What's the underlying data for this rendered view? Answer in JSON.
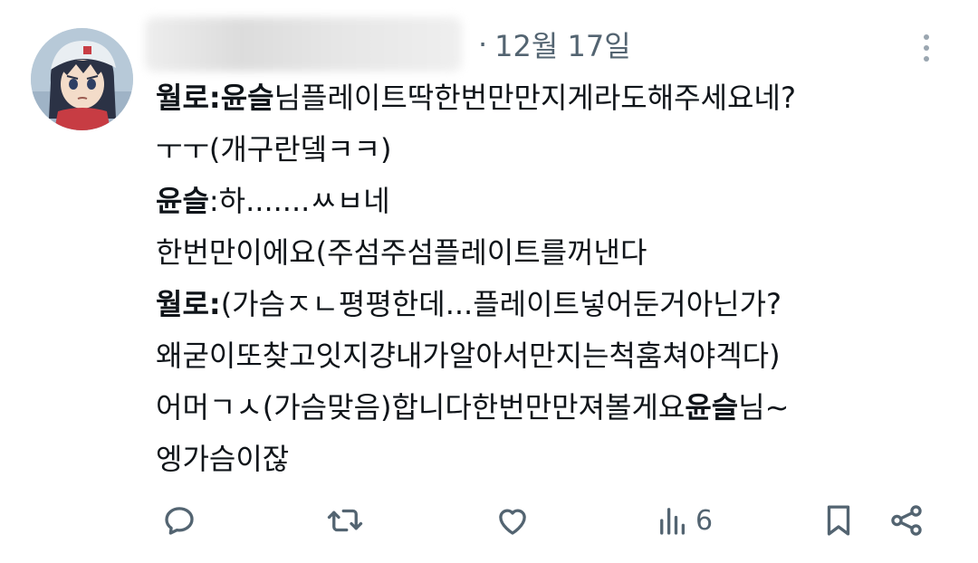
{
  "header": {
    "separator": "·",
    "date": "12월 17일"
  },
  "tweet": {
    "lines": [
      [
        {
          "text": "월로:",
          "bold": true
        },
        {
          "text": "윤슬",
          "bold": true
        },
        {
          "text": "님플레이트딱한번만만지게라도해주세요네?",
          "bold": false
        }
      ],
      [
        {
          "text": "ㅜㅜ(개구란뎈ㅋㅋ)",
          "bold": false
        }
      ],
      [
        {
          "text": "윤슬",
          "bold": true
        },
        {
          "text": ":하.......ㅆㅂ네",
          "bold": false
        }
      ],
      [
        {
          "text": "한번만이에요(주섬주섬플레이트를꺼낸다",
          "bold": false
        }
      ],
      [
        {
          "text": "월로:",
          "bold": true
        },
        {
          "text": "(가슴ㅈㄴ평평한데...플레이트넣어둔거아닌가?",
          "bold": false
        }
      ],
      [
        {
          "text": "왜굳이또찾고잇지걍내가알아서만지는척훔쳐야겍다)",
          "bold": false
        }
      ],
      [
        {
          "text": "어머ㄱㅅ(가슴맞음)합니다한번만만져볼게요",
          "bold": false
        },
        {
          "text": "윤슬",
          "bold": true
        },
        {
          "text": "님~",
          "bold": false
        }
      ],
      [
        {
          "text": "엥가슴이잖",
          "bold": false
        }
      ]
    ]
  },
  "actions": {
    "reply_icon": "reply-icon",
    "retweet_icon": "retweet-icon",
    "like_icon": "heart-icon",
    "views_icon": "views-icon",
    "views_count": "6",
    "bookmark_icon": "bookmark-icon",
    "share_icon": "share-icon"
  },
  "colors": {
    "text": "#0f1419",
    "secondary": "#536471",
    "background": "#ffffff"
  }
}
